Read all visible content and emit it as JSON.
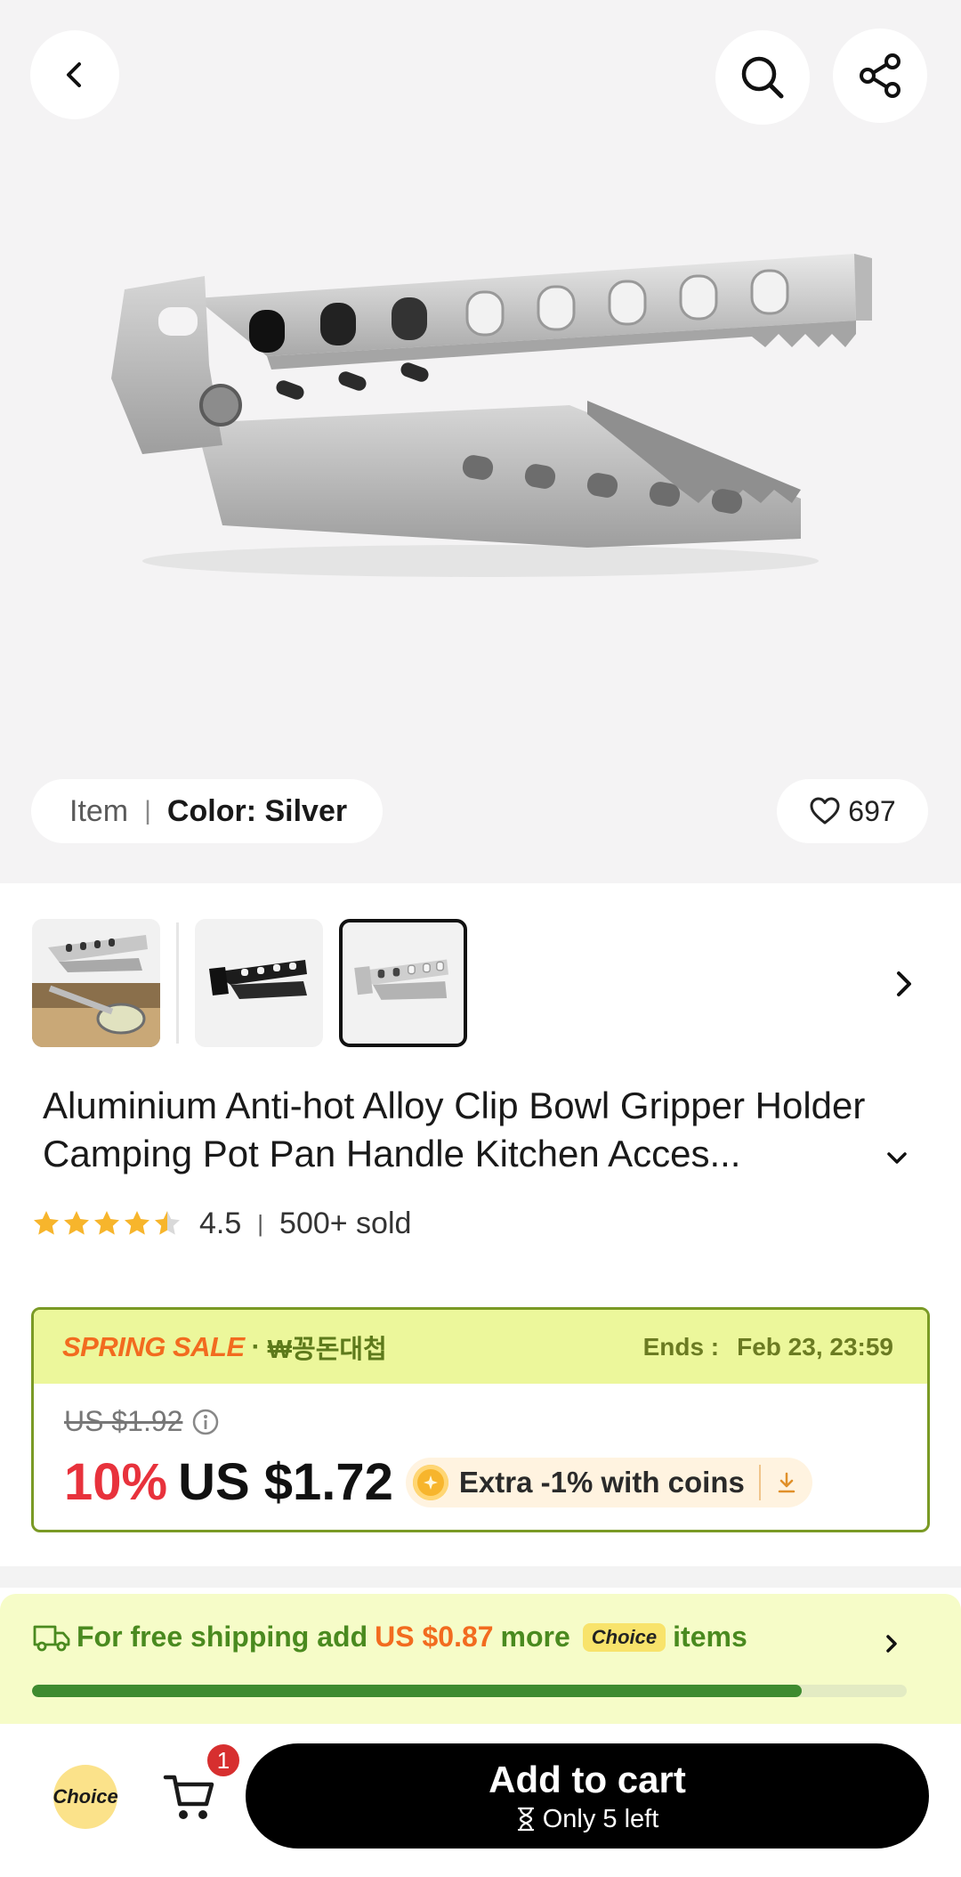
{
  "gallery": {
    "item_label": "Item",
    "separator": "|",
    "color_label": "Color: Silver",
    "favorites_count": "697"
  },
  "product": {
    "title": "Aluminium Anti-hot Alloy Clip Bowl Gripper Holder Camping Pot Pan Handle Kitchen Acces...",
    "rating_value": 4.5,
    "rating_text": "4.5",
    "rating_divider": "|",
    "sold": "500+ sold"
  },
  "sale": {
    "event": "SPRING SALE",
    "dot": "·",
    "coupon_text": "₩꽁돈대첩",
    "ends_label": "Ends :",
    "ends_time": "Feb 23, 23:59",
    "original_price": "US $1.92",
    "discount": "10%",
    "price": "US $1.72",
    "coins_text": "Extra -1% with coins"
  },
  "shipping": {
    "prefix": "For free shipping add",
    "amount": "US $0.87",
    "middle": "more",
    "choice_tag": "Choice",
    "suffix": "items",
    "progress_fraction": 0.88
  },
  "bottom_bar": {
    "choice_label": "Choice",
    "cart_count": "1",
    "add_to_cart": "Add to cart",
    "stock": "Only 5 left"
  },
  "colors": {
    "accent_red": "#e8323c",
    "sale_orange": "#f26b1f",
    "sale_green": "#7a9a25",
    "progress_green": "#3e8b2f",
    "button_black": "#000000"
  }
}
